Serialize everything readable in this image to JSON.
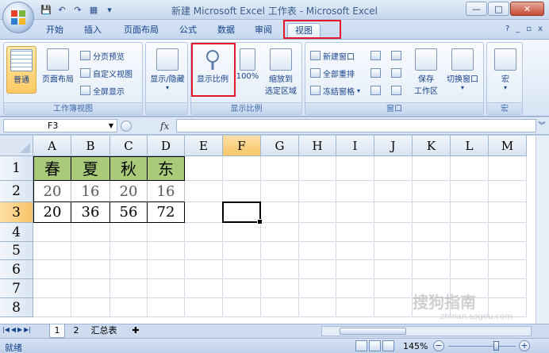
{
  "window": {
    "title": "新建 Microsoft Excel 工作表 - Microsoft Excel",
    "minimize": "—",
    "maximize": "□",
    "close": "✕"
  },
  "qat": [
    "💾",
    "↶",
    "↷",
    "▦",
    "▾"
  ],
  "tabs": [
    {
      "label": "开始"
    },
    {
      "label": "插入"
    },
    {
      "label": "页面布局"
    },
    {
      "label": "公式"
    },
    {
      "label": "数据"
    },
    {
      "label": "审阅"
    },
    {
      "label": "视图",
      "active": true
    }
  ],
  "tab_right": {
    "help": "?",
    "min": "_",
    "restore": "▫",
    "close": "x"
  },
  "ribbon": {
    "workbook_views": {
      "label": "工作簿视图",
      "normal": "普通",
      "page_layout": "页面布局",
      "page_break": "分页预览",
      "custom_view": "自定义视图",
      "full_screen": "全屏显示"
    },
    "show_hide": {
      "label": "显示/隐藏"
    },
    "zoom": {
      "label": "显示比例",
      "zoom_btn": "显示比例",
      "hundred": "100%",
      "zoom_selection_1": "缩放到",
      "zoom_selection_2": "选定区域"
    },
    "window": {
      "label": "窗口",
      "new_window": "新建窗口",
      "arrange_all": "全部重排",
      "freeze_panes": "冻结窗格",
      "save_workspace_1": "保存",
      "save_workspace_2": "工作区",
      "switch_windows": "切换窗口"
    },
    "macros": {
      "label": "宏",
      "macros_btn": "宏"
    }
  },
  "formula_bar": {
    "name_box": "F3",
    "fx": "fx",
    "formula": ""
  },
  "columns": [
    "A",
    "B",
    "C",
    "D",
    "E",
    "F",
    "G",
    "H",
    "I",
    "J",
    "K",
    "L",
    "M"
  ],
  "rows": [
    "1",
    "2",
    "3",
    "4",
    "5",
    "6",
    "7",
    "8"
  ],
  "cells": {
    "row1": [
      "春",
      "夏",
      "秋",
      "东"
    ],
    "row2": [
      "20",
      "16",
      "20",
      "16"
    ],
    "row3": [
      "20",
      "36",
      "56",
      "72"
    ]
  },
  "active_cell": "F3",
  "sheet_tabs": [
    {
      "label": "1",
      "active": true
    },
    {
      "label": "2"
    },
    {
      "label": "汇总表"
    }
  ],
  "status": {
    "ready": "就绪",
    "zoom": "145%",
    "zoom_level": 0.72
  },
  "watermark": {
    "text": "搜狗指南",
    "url": "zhinan.sogou.com"
  }
}
